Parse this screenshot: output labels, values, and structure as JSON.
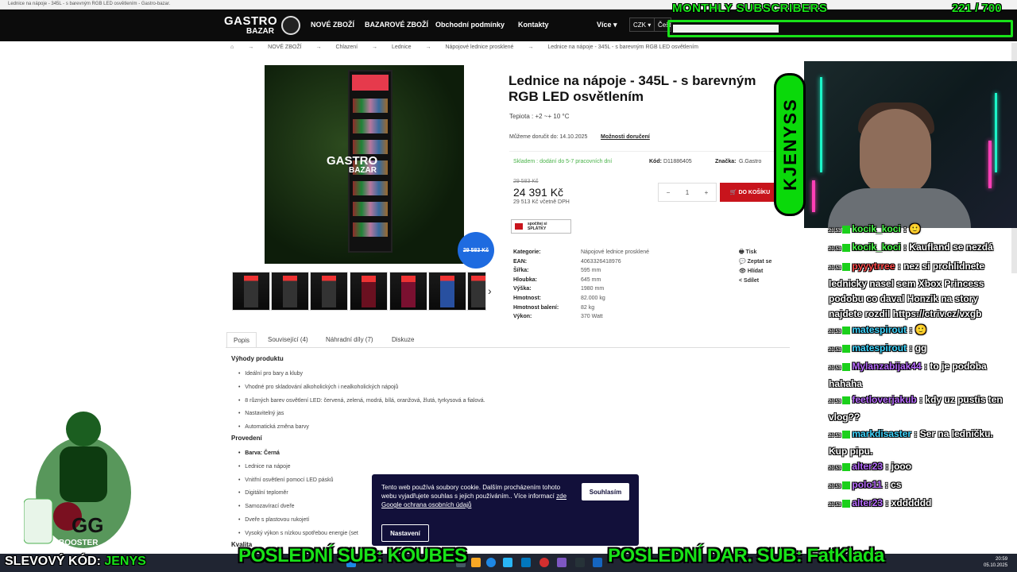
{
  "browser_tab": "Lednice na nápoje - 345L - s barevným RGB LED osvětlením - Gastro-bazar.",
  "nav": {
    "logo_top": "GASTRO",
    "logo_bottom": "BAZAR",
    "links": [
      "NOVÉ ZBOŽÍ",
      "BAZAROVÉ ZBOŽÍ",
      "Obchodní podmínky",
      "Kontakty"
    ],
    "more": "Více ▾",
    "currency": "CZK ▾",
    "language": "Češt"
  },
  "breadcrumb": [
    "⌂",
    "→",
    "NOVÉ ZBOŽÍ",
    "→",
    "Chlazení",
    "→",
    "Lednice",
    "→",
    "Nápojové lednice prosklené",
    "→",
    "Lednice na nápoje - 345L - s barevným RGB LED osvětlením"
  ],
  "product": {
    "title": "Lednice na nápoje - 345L - s barevným RGB LED osvětlením",
    "temperature": "Tepiota : +2 ~+ 10 °C",
    "delivery": "Můžeme doručit do: 14.10.2025",
    "delivery_link": "Možnosti doručení",
    "stock": "Skladem : dodání do 5-7 pracovních dní",
    "code_label": "Kód:",
    "code": "D11886405",
    "brand_label": "Značka:",
    "brand": "G.Gastro",
    "old_price": "29 583 Kč",
    "price": "24 391 Kč",
    "price_vat": "29 513 Kč včetně DPH",
    "qty_minus": "−",
    "qty": "1",
    "qty_plus": "+",
    "cart": "🛒 DO KOŠÍKU",
    "splatky_top": "spočítej si",
    "splatky": "SPLÁTKY",
    "badge_price": "29 583 Kč",
    "image_logo_top": "GASTRO",
    "image_logo_bottom": "BAZAR"
  },
  "specs": [
    {
      "k": "Kategorie:",
      "v": "Nápojové lednice prosklené"
    },
    {
      "k": "EAN:",
      "v": "4063326418976"
    },
    {
      "k": "Šířka:",
      "v": "595 mm"
    },
    {
      "k": "Hloubka:",
      "v": "645 mm"
    },
    {
      "k": "Výška:",
      "v": "1980 mm"
    },
    {
      "k": "Hmotnost:",
      "v": "82.000 kg"
    },
    {
      "k": "Hmotnost balení:",
      "v": "82 kg"
    },
    {
      "k": "Výkon:",
      "v": "370 Watt"
    }
  ],
  "actions": [
    "🖶  Tisk",
    "💬  Zeptat se",
    "👁  Hlídat",
    "<  Sdílet"
  ],
  "tabs": [
    "Popis",
    "Související (4)",
    "Náhradní díly (7)",
    "Diskuze"
  ],
  "description": {
    "h1": "Výhody produktu",
    "benefits": [
      "Ideální pro bary a kluby",
      "Vhodné pro skladování alkoholických i nealkoholických nápojů",
      "8 různých barev osvětlení LED: červená, zelená, modrá, bílá, oranžová, žlutá, tyrkysová a fialová.",
      "Nastavitelný jas",
      "Automatická změna barvy"
    ],
    "h2": "Provedení",
    "color": "Barva: Černá",
    "features": [
      "Lednice na nápoje",
      "Vnitřní osvětlení pomocí LED pásků",
      "Digitální teploměr",
      "Samozavírací dveře",
      "Dveře s plastovou rukojetí",
      "Vysoký výkon s nízkou spotřebou energie (set"
    ],
    "h3": "Kvalita"
  },
  "cookie": {
    "text": "Tento web používá soubory cookie. Dalším procházením tohoto webu vyjadřujete souhlas s jejich používáním.. Více informací",
    "here": "zde",
    "google": "Google ochrana osobních údajů",
    "agree": "Souhlasím",
    "settings": "Nastavení"
  },
  "stream": {
    "subs_title": "MONTHLY SUBSCRIBERS",
    "subs_count": "221 / 700",
    "subs_progress": 0.316,
    "channel_vertical": "KJENYSS",
    "promo_prefix": "SLEVOVÝ KÓD:",
    "promo_code": "JENYS",
    "last_sub": "POSLEDNÍ SUB: KOUBES",
    "last_gift": "POSLEDNÍ DAR. SUB: FatKlada",
    "clock_time": "20:59",
    "clock_date": "05.10.2025",
    "booster": "BOOSTER"
  },
  "chat": [
    {
      "time": "20:53",
      "user": "kocik_koci",
      "msg": ": 🙂"
    },
    {
      "time": "20:53",
      "user": "kocik_koci",
      "msg": ": Kaufland se nezdá"
    },
    {
      "time": "20:53",
      "user": "pyyytrree",
      "msg": ": nez si prohlidnete lednicky nasel sem Xbox Princess podobu co daval Honzik na story najdete rozdil https://ctriv.cz/vxgb"
    },
    {
      "time": "20:53",
      "user": "matespirout",
      "msg": ": 🙂"
    },
    {
      "time": "20:53",
      "user": "matespirout",
      "msg": ": gg"
    },
    {
      "time": "20:53",
      "user": "Mylanzabijak44",
      "msg": ": to je podoba hahaha"
    },
    {
      "time": "20:53",
      "user": "feetloverjakub",
      "msg": ": kdy uz pustis ten vlog??"
    },
    {
      "time": "20:53",
      "user": "markdisaster",
      "msg": ": Ser na ledničku. Kup pipu."
    },
    {
      "time": "20:53",
      "user": "alter23",
      "msg": ": jooo"
    },
    {
      "time": "20:53",
      "user": "polo11",
      "msg": ": cs"
    },
    {
      "time": "20:53",
      "user": "alter23",
      "msg": ": xdddddd"
    }
  ]
}
